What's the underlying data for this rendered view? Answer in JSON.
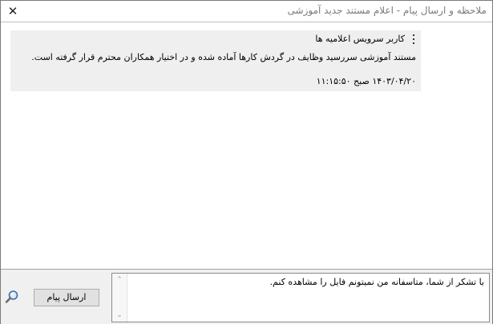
{
  "window": {
    "title": "ملاحظه و ارسال پیام - اعلام مستند جدید آموزشی",
    "close_glyph": "✕"
  },
  "message": {
    "sender": "کاربر سرویس اعلامیه ها",
    "body": "مستند آموزشی سررسید وظایف در گردش کارها آماده شده و در اختیار همکاران محترم قرار گرفته است.",
    "timestamp": "۱۴۰۳/۰۴/۲۰ صبح ۱۱:۱۵:۵۰",
    "menu_icon": "kebab-menu-icon"
  },
  "compose": {
    "text": "با تشکر از شما، متاسفانه من نمیتونم فایل را مشاهده کنم.",
    "send_label": "ارسال پیام",
    "scroll_up_glyph": "⌃",
    "scroll_down_glyph": "⌄",
    "search_icon": "magnifier-icon"
  }
}
